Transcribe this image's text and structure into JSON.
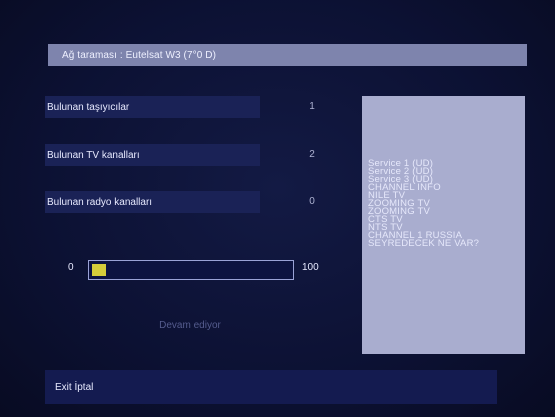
{
  "header": {
    "title": "Ağ taraması : Eutelsat W3 (7°0 D)"
  },
  "scan_results": [
    {
      "label": "Bulunan taşıyıcılar",
      "value": "1"
    },
    {
      "label": "Bulunan TV kanalları",
      "value": "2"
    },
    {
      "label": "Bulunan radyo kanalları",
      "value": "0"
    }
  ],
  "progress": {
    "min_label": "0",
    "max_label": "100",
    "percent": 7,
    "status": "Devam ediyor"
  },
  "channels": [
    "Service 1 (UD)",
    "Service 2 (UD)",
    "Service 3 (UD)",
    "CHANNEL INFO",
    "NILE TV",
    "ZOOMING TV",
    "ZOOMING TV",
    "CTS TV",
    "NTS TV",
    "CHANNEL 1 RUSSIA",
    "SEYREDECEK NE VAR?"
  ],
  "footer": {
    "hint": "Exit İptal"
  },
  "colors": {
    "background": "#0c1133",
    "title_bar": "#7e84ad",
    "row_bg": "#1a2256",
    "panel_bg": "#a9adcf",
    "progress_fill": "#d6cd3a",
    "footer_bg": "#141b50"
  }
}
